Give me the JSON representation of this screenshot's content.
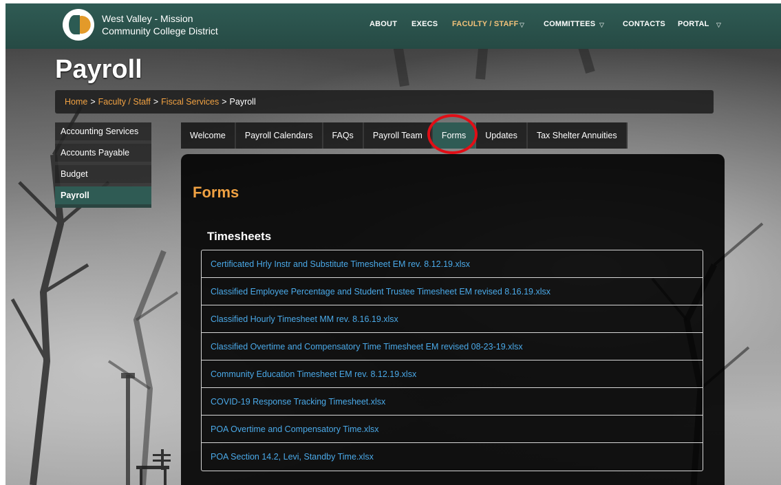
{
  "brand": {
    "line1": "West Valley - Mission",
    "line2": "Community College District",
    "logo_icon": "wvm-logo-icon"
  },
  "nav": {
    "items": [
      {
        "label": "ABOUT"
      },
      {
        "label": "EXECS"
      },
      {
        "label": "FACULTY / STAFF",
        "active": true,
        "has_caret": true
      },
      {
        "label": "COMMITTEES",
        "has_caret": true
      },
      {
        "label": "CONTACTS"
      },
      {
        "label": "PORTAL",
        "has_caret": true
      }
    ],
    "caret_icon": "▽"
  },
  "page": {
    "title": "Payroll"
  },
  "breadcrumb": {
    "items": [
      "Home",
      "Faculty / Staff",
      "Fiscal Services",
      "Payroll"
    ],
    "separator": ">"
  },
  "sidebar": {
    "items": [
      {
        "label": "Accounting Services"
      },
      {
        "label": "Accounts Payable"
      },
      {
        "label": "Budget"
      },
      {
        "label": "Payroll",
        "active": true
      }
    ]
  },
  "tabs": {
    "items": [
      {
        "label": "Welcome"
      },
      {
        "label": "Payroll Calendars"
      },
      {
        "label": "FAQs"
      },
      {
        "label": "Payroll Team"
      },
      {
        "label": "Forms",
        "active": true
      },
      {
        "label": "Updates"
      },
      {
        "label": "Tax Shelter Annuities"
      }
    ]
  },
  "content": {
    "title": "Forms",
    "section_title": "Timesheets",
    "files": [
      "Certificated Hrly Instr and Substitute Timesheet EM rev. 8.12.19.xlsx",
      "Classified Employee Percentage and Student Trustee Timesheet EM revised 8.16.19.xlsx",
      "Classified Hourly Timesheet MM rev. 8.16.19.xlsx",
      "Classified Overtime and Compensatory Time Timesheet EM revised 08-23-19.xlsx",
      "Community Education Timesheet EM rev. 8.12.19.xlsx",
      "COVID-19 Response Tracking Timesheet.xlsx",
      "POA Overtime and Compensatory Time.xlsx",
      "POA Section 14.2, Levi, Standby Time.xlsx"
    ]
  },
  "colors": {
    "brand_green": "#2f5b54",
    "accent_orange": "#f0a142",
    "link_blue": "#4aa9e8",
    "highlight_red": "#e10e16"
  }
}
